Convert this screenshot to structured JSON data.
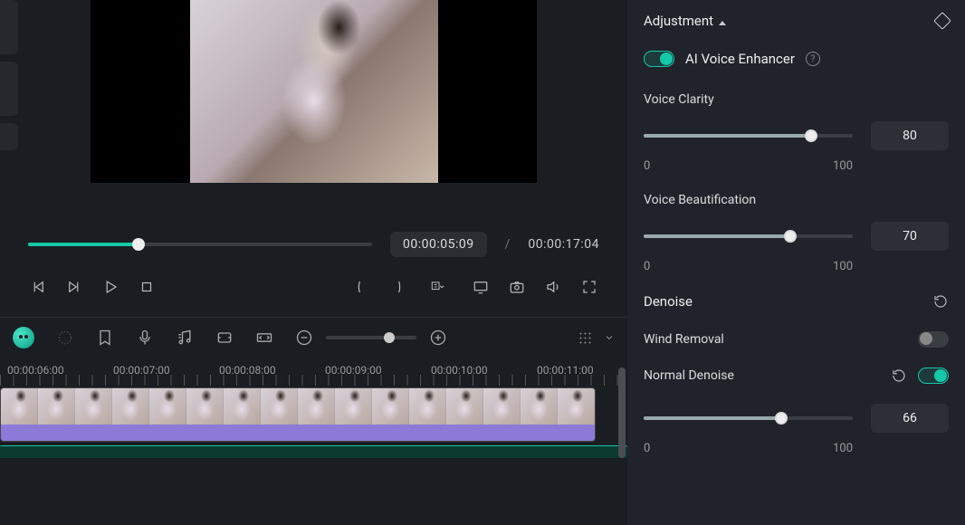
{
  "sections": {
    "adjustment_label": "Adjustment",
    "ai_voice_label": "AI Voice Enhancer",
    "denoise_label": "Denoise"
  },
  "toggles": {
    "ai_voice": true,
    "wind_removal": false,
    "normal_denoise": true
  },
  "options": {
    "wind_removal_label": "Wind Removal",
    "normal_denoise_label": "Normal Denoise"
  },
  "sliders": {
    "voice_clarity": {
      "label": "Voice Clarity",
      "value": 80,
      "min": 0,
      "max": 100
    },
    "voice_beautification": {
      "label": "Voice Beautification",
      "value": 70,
      "min": 0,
      "max": 100
    },
    "normal_denoise": {
      "value": 66,
      "min": 0,
      "max": 100
    }
  },
  "transport": {
    "current_time": "00:00:05:09",
    "total_time": "00:00:17:04",
    "separator": "/",
    "seek_percent": 32
  },
  "ruler": {
    "ticks": [
      "00:00:06:00",
      "00:00:07:00",
      "00:00:08:00",
      "00:00:09:00",
      "00:00:10:00",
      "00:00:11:00"
    ]
  },
  "colors": {
    "accent": "#14c8a8",
    "purple_track": "#8b7ad8",
    "bg": "#1a1d21",
    "panel": "#20232a"
  }
}
